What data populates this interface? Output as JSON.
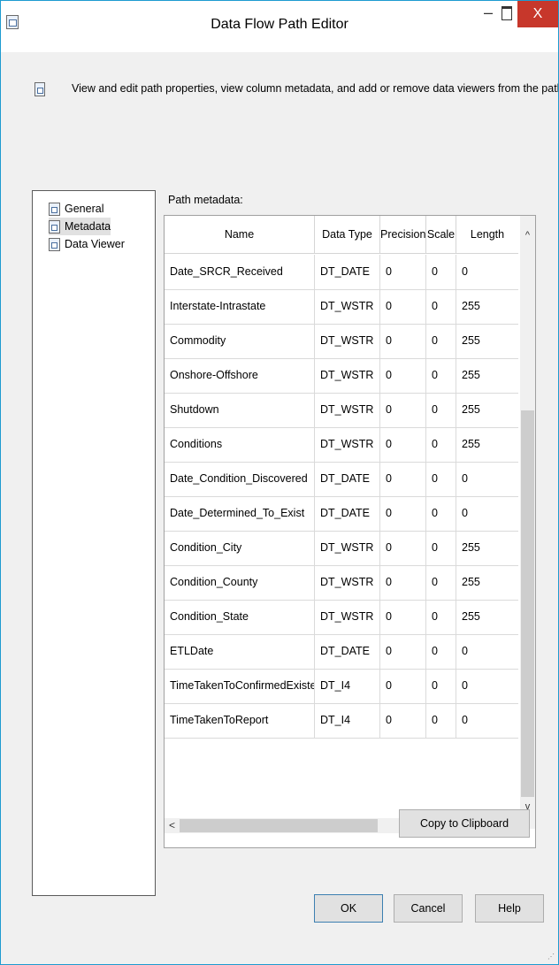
{
  "window": {
    "title": "Data Flow Path Editor",
    "minimize_glyph": "–",
    "close_label": "X"
  },
  "description": "View and edit path properties, view column metadata, and add or remove data viewers from the path.",
  "nav": {
    "items": [
      {
        "label": "General",
        "icon": "page-icon",
        "selected": false
      },
      {
        "label": "Metadata",
        "icon": "page-icon",
        "selected": true
      },
      {
        "label": "Data Viewer",
        "icon": "page-icon",
        "selected": false
      }
    ]
  },
  "path_metadata": {
    "label": "Path metadata:",
    "columns": [
      "Name",
      "Data Type",
      "Precision",
      "Scale",
      "Length"
    ],
    "rows": [
      [
        "Date_SRCR_Received",
        "DT_DATE",
        "0",
        "0",
        "0"
      ],
      [
        "Interstate-Intrastate",
        "DT_WSTR",
        "0",
        "0",
        "255"
      ],
      [
        "Commodity",
        "DT_WSTR",
        "0",
        "0",
        "255"
      ],
      [
        "Onshore-Offshore",
        "DT_WSTR",
        "0",
        "0",
        "255"
      ],
      [
        "Shutdown",
        "DT_WSTR",
        "0",
        "0",
        "255"
      ],
      [
        "Conditions",
        "DT_WSTR",
        "0",
        "0",
        "255"
      ],
      [
        "Date_Condition_Discovered",
        "DT_DATE",
        "0",
        "0",
        "0"
      ],
      [
        "Date_Determined_To_Exist",
        "DT_DATE",
        "0",
        "0",
        "0"
      ],
      [
        "Condition_City",
        "DT_WSTR",
        "0",
        "0",
        "255"
      ],
      [
        "Condition_County",
        "DT_WSTR",
        "0",
        "0",
        "255"
      ],
      [
        "Condition_State",
        "DT_WSTR",
        "0",
        "0",
        "255"
      ],
      [
        "ETLDate",
        "DT_DATE",
        "0",
        "0",
        "0"
      ],
      [
        "TimeTakenToConfirmedExistence",
        "DT_I4",
        "0",
        "0",
        "0"
      ],
      [
        "TimeTakenToReport",
        "DT_I4",
        "0",
        "0",
        "0"
      ]
    ],
    "scroll_up_glyph": "^",
    "scroll_down_glyph": "v",
    "scroll_left_glyph": "<",
    "scroll_right_glyph": ">"
  },
  "buttons": {
    "copy": "Copy to Clipboard",
    "ok": "OK",
    "cancel": "Cancel",
    "help": "Help"
  },
  "colors": {
    "window_border": "#1e9bd0",
    "close_button": "#c7372b"
  }
}
